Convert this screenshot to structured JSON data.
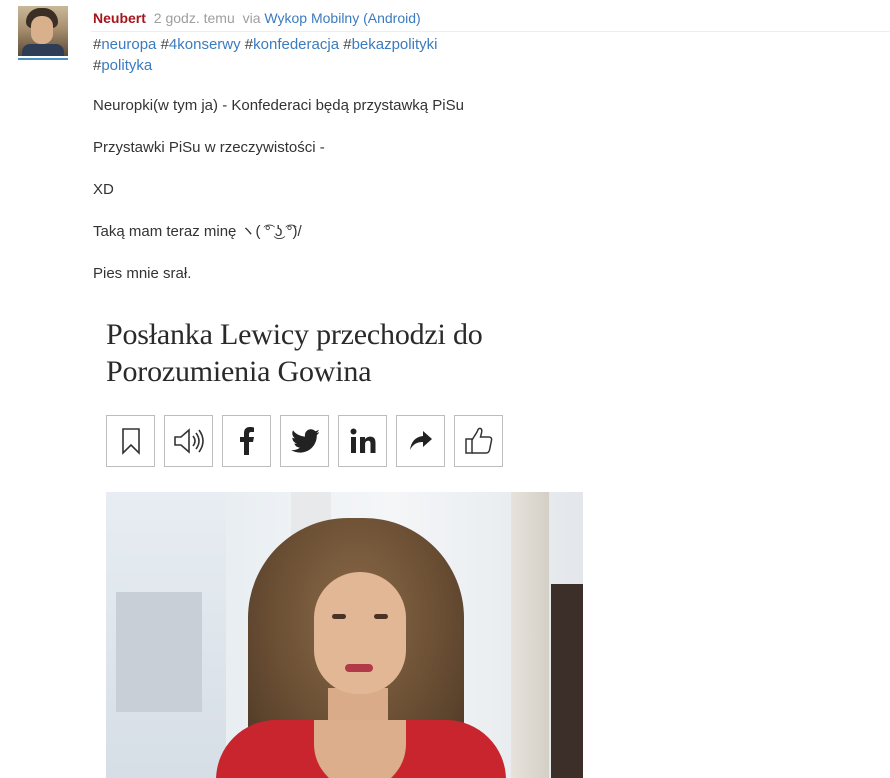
{
  "post": {
    "author": "Neubert",
    "time": "2 godz. temu",
    "via_label": "via",
    "client": "Wykop Mobilny (Android)",
    "tags": [
      {
        "hash": "#",
        "name": "neuropa"
      },
      {
        "hash": "#",
        "name": "4konserwy"
      },
      {
        "hash": "#",
        "name": "konfederacja"
      },
      {
        "hash": "#",
        "name": "bekazpolityki"
      },
      {
        "hash": "#",
        "name": "polityka"
      }
    ],
    "lines": [
      "Neuropki(w tym ja) - Konfederaci będą przystawką PiSu",
      "Przystawki PiSu w rzeczywistości -",
      "XD",
      "Taką mam teraz minę ヽ( ͡° ͜ʖ ͡°)/",
      "Pies mnie srał."
    ]
  },
  "embed": {
    "headline_1": "Posłanka Lewicy przechodzi do",
    "headline_2": "Porozumienia Gowina",
    "share_icons": [
      "bookmark-icon",
      "speaker-icon",
      "facebook-icon",
      "twitter-icon",
      "linkedin-icon",
      "share-arrow-icon",
      "thumbs-up-icon"
    ]
  },
  "colors": {
    "author": "#a5161c",
    "link": "#3b7bbf",
    "muted": "#9e9e9e"
  }
}
